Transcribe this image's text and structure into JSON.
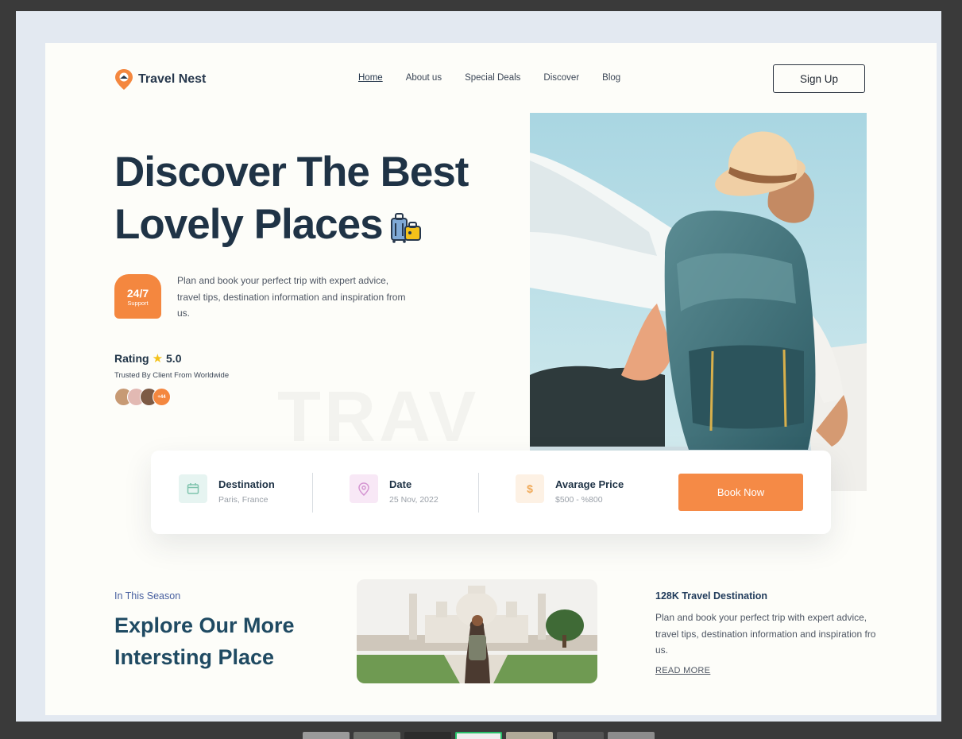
{
  "header": {
    "logo_text": "Travel Nest",
    "nav": [
      "Home",
      "About us",
      "Special Deals",
      "Discover",
      "Blog"
    ],
    "active_nav": "Home",
    "signup_label": "Sign Up"
  },
  "hero": {
    "title_line1": "Discover The Best",
    "title_line2": "Lovely Places",
    "support_big": "24/7",
    "support_small": "Support",
    "description": "Plan and book your perfect trip with expert advice, travel tips, destination information and inspiration from us.",
    "rating_label": "Rating",
    "rating_value": "5.0",
    "trusted_text": "Trusted By Client From Worldwide",
    "avatars_more": "+44",
    "watermark": "TRAV"
  },
  "booking": {
    "destination_label": "Destination",
    "destination_value": "Paris, France",
    "date_label": "Date",
    "date_value": "25 Nov, 2022",
    "price_label": "Avarage Price",
    "price_value": "$500 - %800",
    "price_icon": "$",
    "book_label": "Book Now"
  },
  "season": {
    "eyebrow": "In This Season",
    "title_line1": "Explore Our More",
    "title_line2": "Intersting Place",
    "dest_title": "128K Travel Destination",
    "dest_desc": "Plan and book your perfect trip with expert advice, travel tips, destination information and inspiration fro us.",
    "read_more": "READ MORE"
  },
  "colors": {
    "accent": "#f58a46",
    "heading": "#1f3346",
    "background": "#fdfdf9"
  }
}
